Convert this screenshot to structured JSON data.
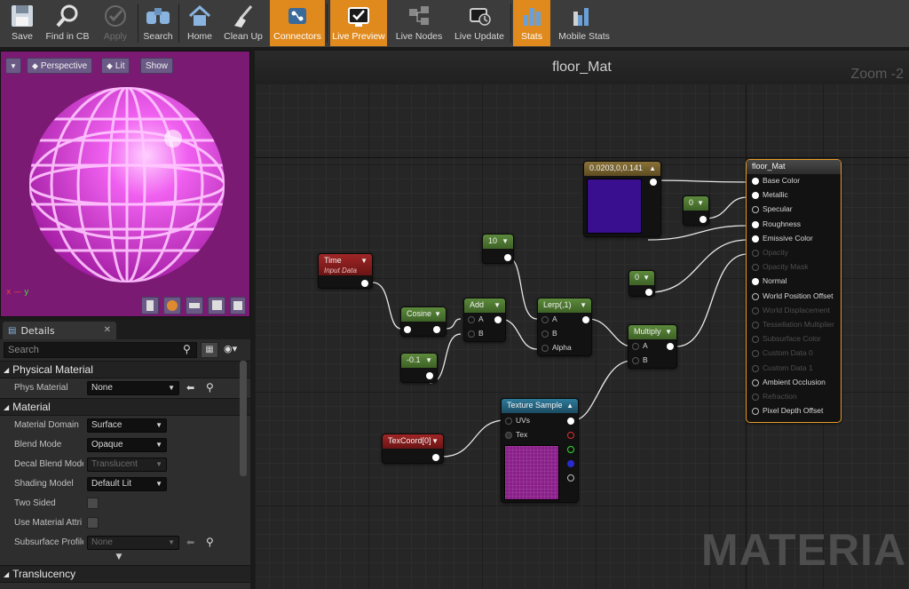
{
  "toolbar": {
    "buttons": [
      {
        "label": "Save",
        "icon": "save-icon",
        "state": "normal"
      },
      {
        "label": "Find in CB",
        "icon": "find-in-cb-icon",
        "state": "normal"
      },
      {
        "label": "Apply",
        "icon": "apply-check-icon",
        "state": "disabled"
      },
      {
        "label": "Search",
        "icon": "search-binoculars-icon",
        "state": "normal"
      },
      {
        "label": "Home",
        "icon": "home-icon",
        "state": "normal"
      },
      {
        "label": "Clean Up",
        "icon": "broom-icon",
        "state": "normal"
      },
      {
        "label": "Connectors",
        "icon": "connectors-icon",
        "state": "active"
      },
      {
        "label": "Live Preview",
        "icon": "live-preview-icon",
        "state": "active"
      },
      {
        "label": "Live Nodes",
        "icon": "live-nodes-icon",
        "state": "normal"
      },
      {
        "label": "Live Update",
        "icon": "live-update-icon",
        "state": "normal"
      },
      {
        "label": "Stats",
        "icon": "stats-icon",
        "state": "active"
      },
      {
        "label": "Mobile Stats",
        "icon": "mobile-stats-icon",
        "state": "normal"
      }
    ]
  },
  "viewport": {
    "perspective_label": "Perspective",
    "lit_label": "Lit",
    "show_label": "Show",
    "axis_x": "x",
    "axis_y": "y",
    "background_color": "#7a1a73",
    "sphere_color": "#e040e0"
  },
  "details": {
    "tab_label": "Details",
    "search_placeholder": "Search",
    "sections": {
      "physical_material": {
        "title": "Physical Material",
        "phys_material_label": "Phys Material",
        "phys_material_value": "None"
      },
      "material": {
        "title": "Material",
        "material_domain_label": "Material Domain",
        "material_domain_value": "Surface",
        "blend_mode_label": "Blend Mode",
        "blend_mode_value": "Opaque",
        "decal_blend_mode_label": "Decal Blend Mode",
        "decal_blend_mode_value": "Translucent",
        "shading_model_label": "Shading Model",
        "shading_model_value": "Default Lit",
        "two_sided_label": "Two Sided",
        "use_material_attr_label": "Use Material Attri",
        "subsurface_profile_label": "Subsurface Profile",
        "subsurface_profile_value": "None"
      },
      "translucency": {
        "title": "Translucency"
      }
    }
  },
  "graph": {
    "title": "floor_Mat",
    "zoom_label": "Zoom -2",
    "watermark": "MATERIAL",
    "nodes": {
      "time": {
        "title": "Time",
        "subtitle": "Input Data"
      },
      "cosine": {
        "title": "Cosine"
      },
      "add": {
        "title": "Add",
        "pin_a": "A",
        "pin_b": "B"
      },
      "const_neg": {
        "title": "-0.1"
      },
      "const_10": {
        "title": "10"
      },
      "lerp": {
        "title": "Lerp(,1)",
        "pin_a": "A",
        "pin_b": "B",
        "pin_alpha": "Alpha"
      },
      "multiply": {
        "title": "Multiply",
        "pin_a": "A",
        "pin_b": "B"
      },
      "const_0_a": {
        "title": "0"
      },
      "const_0_b": {
        "title": "0"
      },
      "vector": {
        "title": "0.0203,0,0.141",
        "swatch_color": "#3a0f8f"
      },
      "texcoord": {
        "title": "TexCoord[0]"
      },
      "texture": {
        "title": "Texture Sample",
        "pin_uvs": "UVs",
        "pin_tex": "Tex",
        "swatch_color": "#8a1f8a"
      },
      "result": {
        "title": "floor_Mat",
        "pins": [
          {
            "label": "Base Color",
            "active": true
          },
          {
            "label": "Metallic",
            "active": true
          },
          {
            "label": "Specular",
            "active": true
          },
          {
            "label": "Roughness",
            "active": true
          },
          {
            "label": "Emissive Color",
            "active": true
          },
          {
            "label": "Opacity",
            "active": false
          },
          {
            "label": "Opacity Mask",
            "active": false
          },
          {
            "label": "Normal",
            "active": true
          },
          {
            "label": "World Position Offset",
            "active": true
          },
          {
            "label": "World Displacement",
            "active": false
          },
          {
            "label": "Tessellation Multiplier",
            "active": false
          },
          {
            "label": "Subsurface Color",
            "active": false
          },
          {
            "label": "Custom Data 0",
            "active": false
          },
          {
            "label": "Custom Data 1",
            "active": false
          },
          {
            "label": "Ambient Occlusion",
            "active": true
          },
          {
            "label": "Refraction",
            "active": false
          },
          {
            "label": "Pixel Depth Offset",
            "active": true
          }
        ]
      }
    }
  }
}
